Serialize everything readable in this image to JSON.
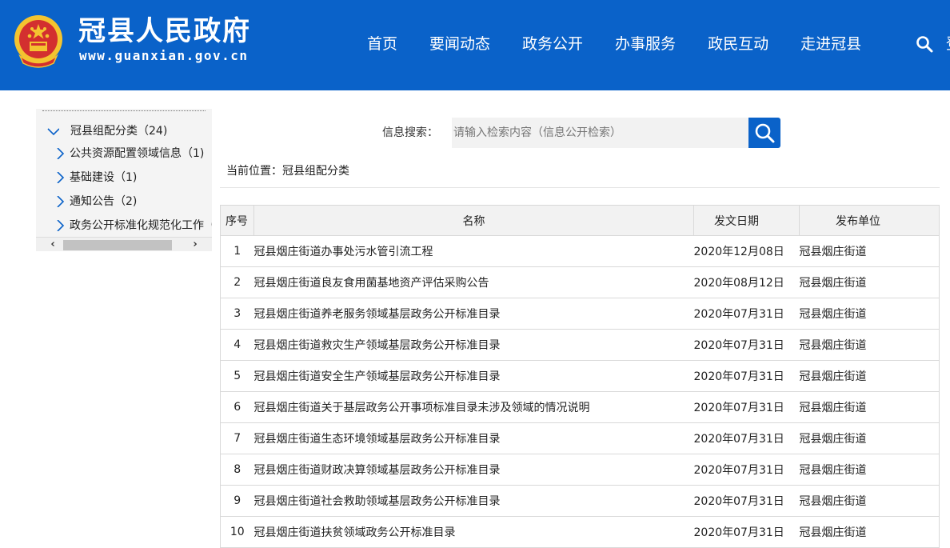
{
  "header": {
    "title": "冠县人民政府",
    "url": "www.guanxian.gov.cn",
    "nav": [
      "首页",
      "要闻动态",
      "政务公开",
      "办事服务",
      "政民互动",
      "走进冠县"
    ],
    "search_icon": "search-icon",
    "emblem_icon": "national-emblem-icon",
    "colors": {
      "brand": "#0a62c9"
    }
  },
  "sidebar": {
    "root": {
      "label": "冠县组配分类（24)"
    },
    "items": [
      {
        "label": "公共资源配置领域信息（1)"
      },
      {
        "label": "基础建设（1)"
      },
      {
        "label": "通知公告（2)"
      },
      {
        "label": "政务公开标准化规范化工作（"
      }
    ]
  },
  "search": {
    "label": "信息搜索：",
    "placeholder": "请输入检索内容（信息公开检索）"
  },
  "location": "当前位置：冠县组配分类",
  "table": {
    "headers": {
      "no": "序号",
      "name": "名称",
      "date": "发文日期",
      "unit": "发布单位"
    },
    "rows": [
      {
        "no": "1",
        "name": "冠县烟庄街道办事处污水管引流工程",
        "date": "2020年12月08日",
        "unit": "冠县烟庄街道"
      },
      {
        "no": "2",
        "name": "冠县烟庄街道良友食用菌基地资产评估采购公告",
        "date": "2020年08月12日",
        "unit": "冠县烟庄街道"
      },
      {
        "no": "3",
        "name": "冠县烟庄街道养老服务领域基层政务公开标准目录",
        "date": "2020年07月31日",
        "unit": "冠县烟庄街道"
      },
      {
        "no": "4",
        "name": "冠县烟庄街道救灾生产领域基层政务公开标准目录",
        "date": "2020年07月31日",
        "unit": "冠县烟庄街道"
      },
      {
        "no": "5",
        "name": "冠县烟庄街道安全生产领域基层政务公开标准目录",
        "date": "2020年07月31日",
        "unit": "冠县烟庄街道"
      },
      {
        "no": "6",
        "name": "冠县烟庄街道关于基层政务公开事项标准目录未涉及领域的情况说明",
        "date": "2020年07月31日",
        "unit": "冠县烟庄街道"
      },
      {
        "no": "7",
        "name": "冠县烟庄街道生态环境领域基层政务公开标准目录",
        "date": "2020年07月31日",
        "unit": "冠县烟庄街道"
      },
      {
        "no": "8",
        "name": "冠县烟庄街道财政决算领域基层政务公开标准目录",
        "date": "2020年07月31日",
        "unit": "冠县烟庄街道"
      },
      {
        "no": "9",
        "name": "冠县烟庄街道社会救助领域基层政务公开标准目录",
        "date": "2020年07月31日",
        "unit": "冠县烟庄街道"
      },
      {
        "no": "10",
        "name": "冠县烟庄街道扶贫领域政务公开标准目录",
        "date": "2020年07月31日",
        "unit": "冠县烟庄街道"
      }
    ]
  }
}
